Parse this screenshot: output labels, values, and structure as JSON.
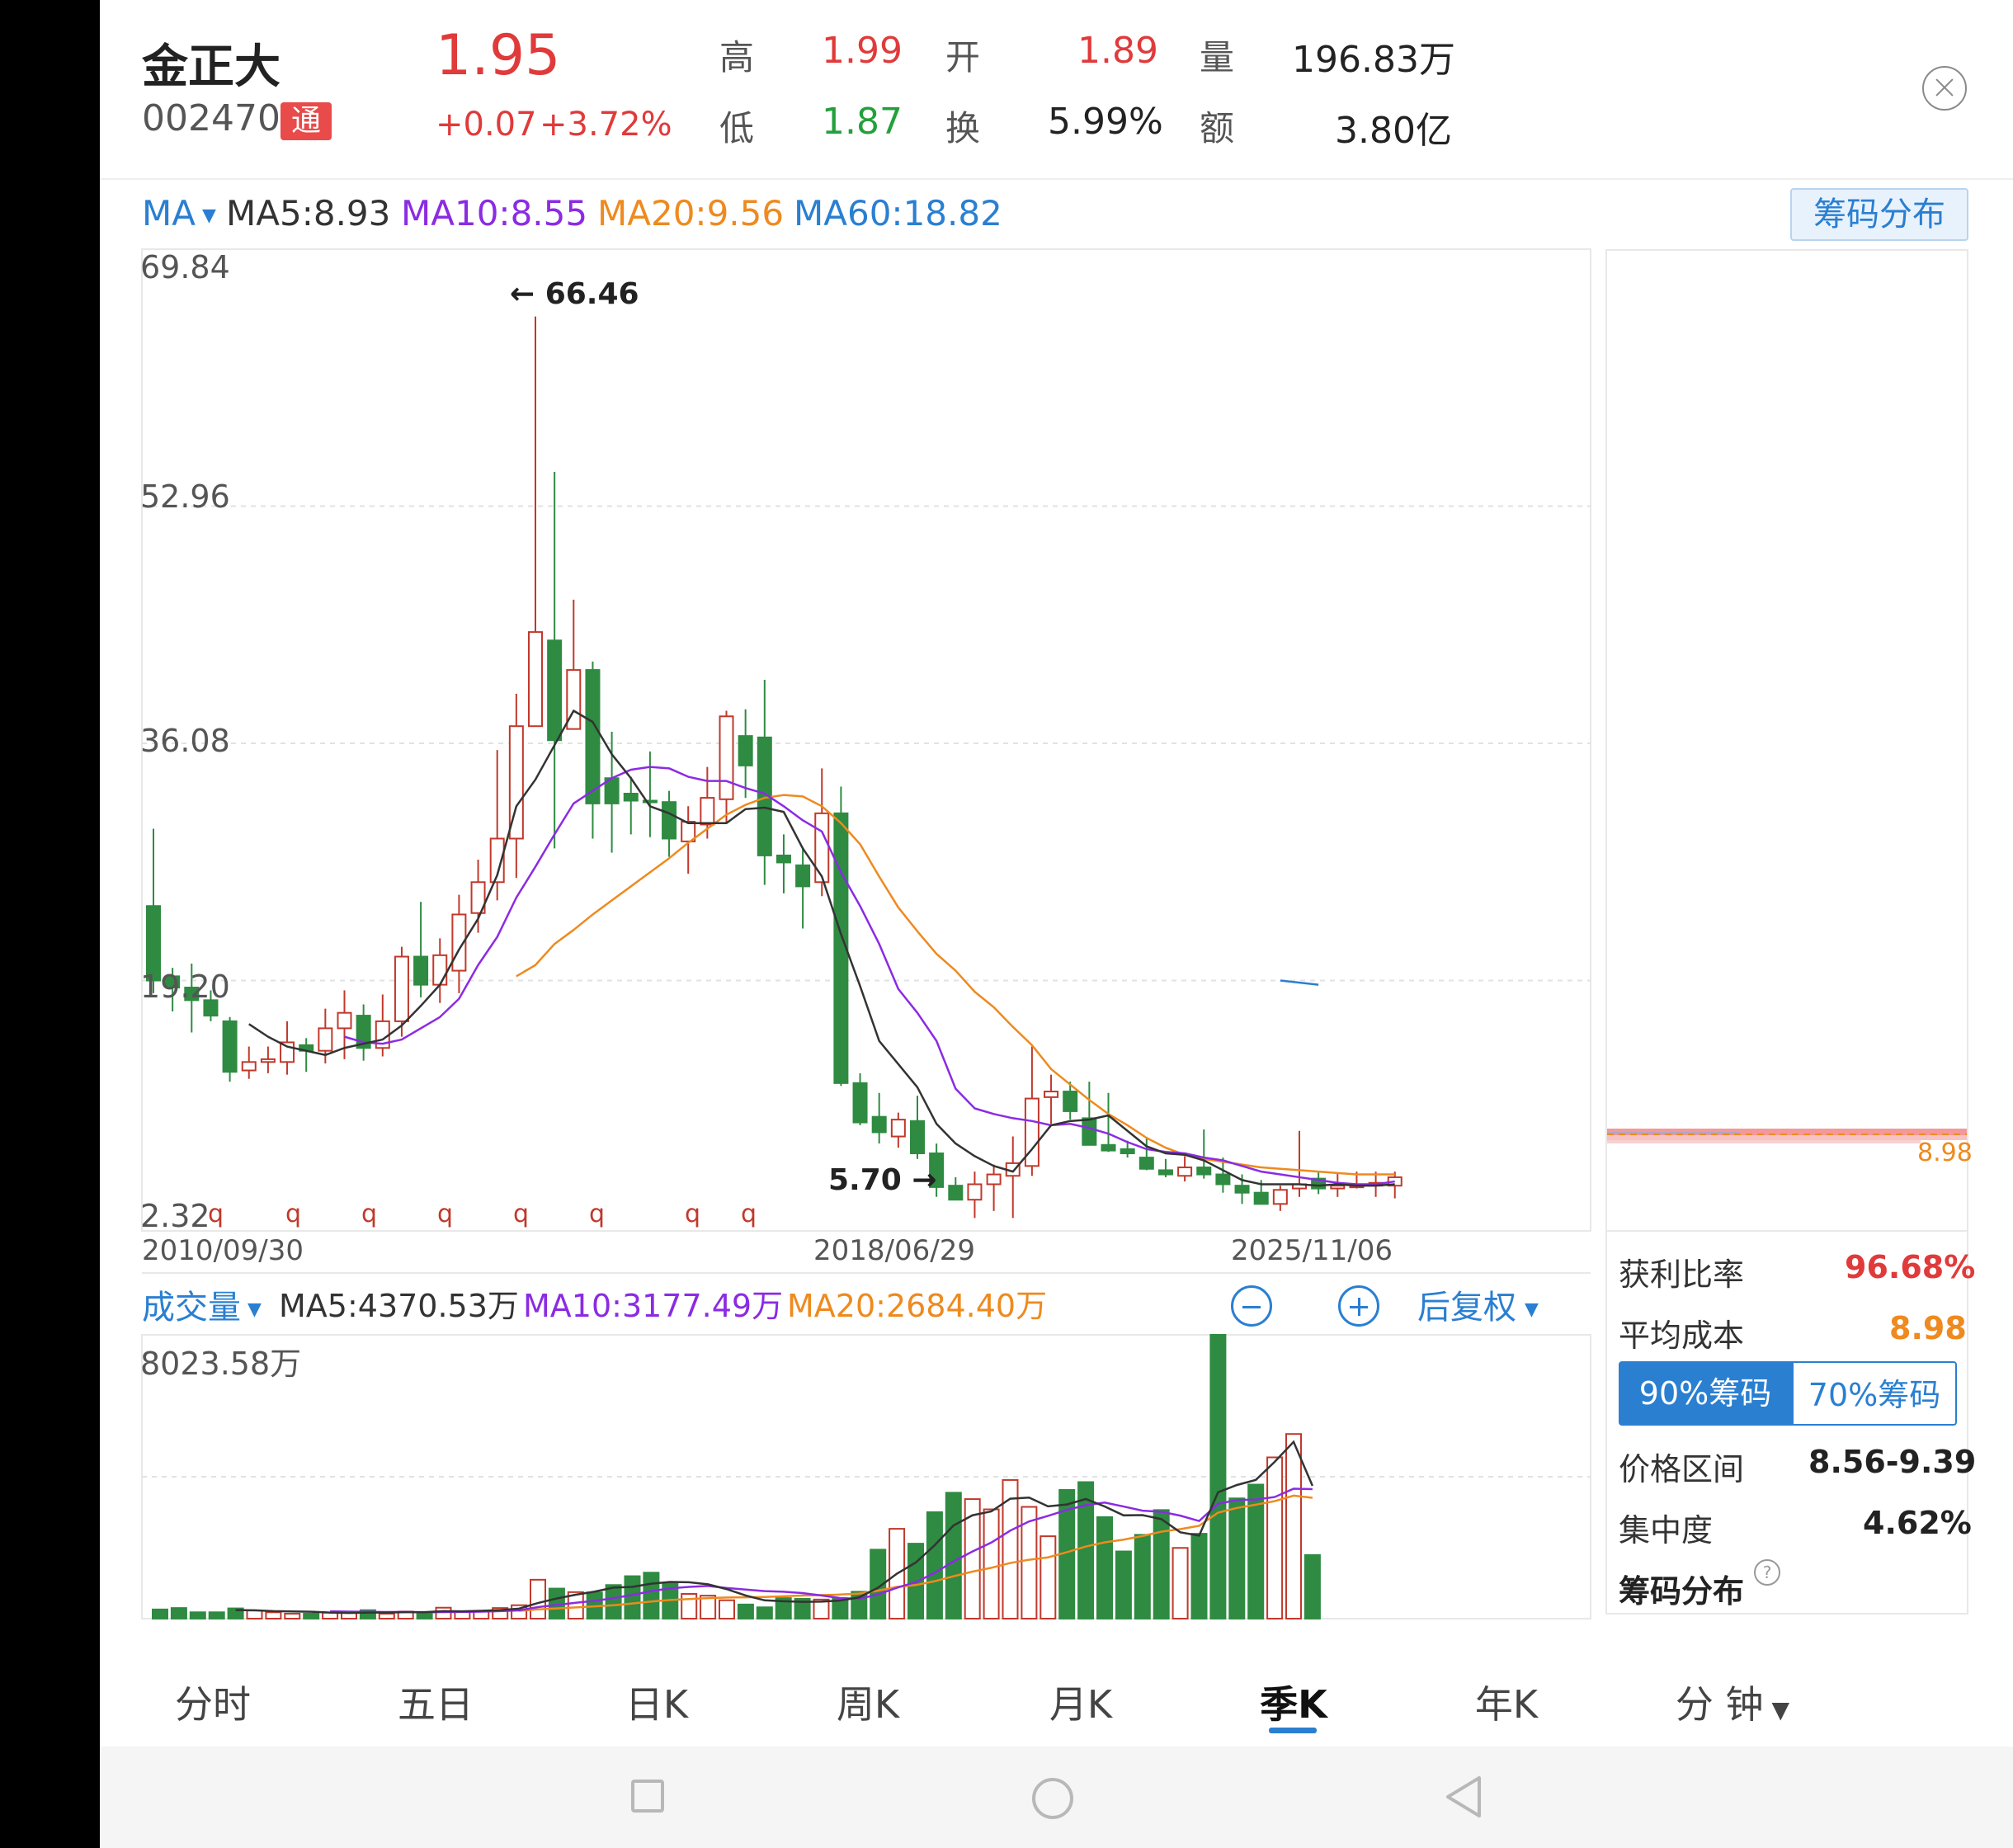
{
  "header": {
    "name": "金正大",
    "code": "002470",
    "tag": "通",
    "price": "1.95",
    "change": "+0.07",
    "change_pct": "+3.72%",
    "high_label": "高",
    "high": "1.99",
    "open_label": "开",
    "open": "1.89",
    "volume_label": "量",
    "volume": "196.83万",
    "low_label": "低",
    "low": "1.87",
    "turnover_label": "换",
    "turnover": "5.99%",
    "amount_label": "额",
    "amount": "3.80亿"
  },
  "ma_bar": {
    "label": "MA",
    "ma5": "MA5:8.93",
    "ma10": "MA10:8.55",
    "ma20": "MA20:9.56",
    "ma60": "MA60:18.82",
    "chips_button": "筹码分布"
  },
  "price_axis": [
    "69.84",
    "52.96",
    "36.08",
    "19.20",
    "2.32"
  ],
  "annotations": {
    "max": "66.46",
    "min": "5.70"
  },
  "q_marker": "q",
  "dates": [
    "2010/09/30",
    "2018/06/29",
    "2025/11/06"
  ],
  "volume_bar": {
    "label": "成交量",
    "ma5": "MA5:4370.53万",
    "ma10": "MA10:3177.49万",
    "ma20": "MA20:2684.40万",
    "max": "8023.58万",
    "adjust": "后复权"
  },
  "chip_panel": {
    "avg_price_marker": "8.98",
    "profit_label": "获利比率",
    "profit": "96.68%",
    "avg_cost_label": "平均成本",
    "avg_cost": "8.98",
    "tab_90": "90%筹码",
    "tab_70": "70%筹码",
    "range_label": "价格区间",
    "range": "8.56-9.39",
    "concentration_label": "集中度",
    "concentration": "4.62%",
    "footer": "筹码分布"
  },
  "tabs": [
    "分时",
    "五日",
    "日K",
    "周K",
    "月K",
    "季K",
    "年K",
    "分 钟"
  ],
  "active_tab": "季K",
  "colors": {
    "up": "#c0392b",
    "down": "#2e8b41",
    "ma5": "#333333",
    "ma10": "#8b2be2",
    "ma20": "#ee8a1f",
    "ma60": "#2a7fd1",
    "accent": "#2a7fd1"
  },
  "chart_data": {
    "type": "candlestick",
    "x_start": "2010/09/30",
    "x_end": "2025/11/06",
    "period": "quarter",
    "ylim": [
      2.32,
      69.84
    ],
    "candles": [
      {
        "o": 24.5,
        "h": 30.0,
        "l": 18.3,
        "c": 19.2
      },
      {
        "o": 19.5,
        "h": 20.1,
        "l": 17.0,
        "c": 18.7
      },
      {
        "o": 18.7,
        "h": 20.4,
        "l": 15.5,
        "c": 17.8
      },
      {
        "o": 17.8,
        "h": 18.5,
        "l": 16.3,
        "c": 16.7
      },
      {
        "o": 16.3,
        "h": 16.6,
        "l": 12.0,
        "c": 12.7
      },
      {
        "o": 12.8,
        "h": 14.5,
        "l": 12.2,
        "c": 13.4
      },
      {
        "o": 13.4,
        "h": 14.5,
        "l": 12.6,
        "c": 13.6
      },
      {
        "o": 13.4,
        "h": 16.3,
        "l": 12.5,
        "c": 14.8
      },
      {
        "o": 14.6,
        "h": 15.1,
        "l": 12.7,
        "c": 14.2
      },
      {
        "o": 14.2,
        "h": 17.2,
        "l": 13.3,
        "c": 15.8
      },
      {
        "o": 15.8,
        "h": 18.5,
        "l": 13.6,
        "c": 16.9
      },
      {
        "o": 16.7,
        "h": 17.5,
        "l": 13.5,
        "c": 14.4
      },
      {
        "o": 14.4,
        "h": 18.2,
        "l": 13.8,
        "c": 16.3
      },
      {
        "o": 16.3,
        "h": 21.6,
        "l": 15.2,
        "c": 20.9
      },
      {
        "o": 20.9,
        "h": 24.8,
        "l": 18.0,
        "c": 18.9
      },
      {
        "o": 18.9,
        "h": 22.2,
        "l": 17.6,
        "c": 21.0
      },
      {
        "o": 19.9,
        "h": 25.3,
        "l": 18.3,
        "c": 23.9
      },
      {
        "o": 24.0,
        "h": 27.8,
        "l": 22.6,
        "c": 26.2
      },
      {
        "o": 26.2,
        "h": 35.6,
        "l": 24.9,
        "c": 29.3
      },
      {
        "o": 29.3,
        "h": 39.6,
        "l": 26.5,
        "c": 37.3
      },
      {
        "o": 37.3,
        "h": 66.46,
        "l": 37.3,
        "c": 44.0
      },
      {
        "o": 43.4,
        "h": 55.4,
        "l": 28.6,
        "c": 36.3
      },
      {
        "o": 37.1,
        "h": 46.3,
        "l": 37.1,
        "c": 41.3
      },
      {
        "o": 41.3,
        "h": 41.9,
        "l": 29.3,
        "c": 31.8
      },
      {
        "o": 33.6,
        "h": 36.9,
        "l": 28.3,
        "c": 31.8
      },
      {
        "o": 32.5,
        "h": 33.7,
        "l": 29.6,
        "c": 32.0
      },
      {
        "o": 32.0,
        "h": 35.5,
        "l": 29.4,
        "c": 31.9
      },
      {
        "o": 31.9,
        "h": 32.7,
        "l": 28.0,
        "c": 29.3
      },
      {
        "o": 29.1,
        "h": 31.6,
        "l": 26.8,
        "c": 30.5
      },
      {
        "o": 30.3,
        "h": 34.4,
        "l": 29.3,
        "c": 32.2
      },
      {
        "o": 32.1,
        "h": 38.4,
        "l": 30.4,
        "c": 38.0
      },
      {
        "o": 36.6,
        "h": 38.5,
        "l": 32.2,
        "c": 34.5
      },
      {
        "o": 36.5,
        "h": 40.6,
        "l": 26.0,
        "c": 28.1
      },
      {
        "o": 28.1,
        "h": 29.6,
        "l": 25.4,
        "c": 27.6
      },
      {
        "o": 27.4,
        "h": 28.7,
        "l": 22.9,
        "c": 25.9
      },
      {
        "o": 26.2,
        "h": 34.3,
        "l": 25.2,
        "c": 31.1
      },
      {
        "o": 31.1,
        "h": 33.0,
        "l": 11.7,
        "c": 11.9
      },
      {
        "o": 11.9,
        "h": 12.6,
        "l": 8.9,
        "c": 9.1
      },
      {
        "o": 9.5,
        "h": 11.2,
        "l": 7.6,
        "c": 8.4
      },
      {
        "o": 8.1,
        "h": 9.8,
        "l": 7.3,
        "c": 9.3
      },
      {
        "o": 9.2,
        "h": 11.0,
        "l": 6.5,
        "c": 6.9
      },
      {
        "o": 6.9,
        "h": 7.6,
        "l": 3.8,
        "c": 4.5
      },
      {
        "o": 4.6,
        "h": 5.2,
        "l": 3.6,
        "c": 3.6
      },
      {
        "o": 3.6,
        "h": 5.6,
        "l": 2.3,
        "c": 4.7
      },
      {
        "o": 4.7,
        "h": 6.1,
        "l": 2.8,
        "c": 5.4
      },
      {
        "o": 5.3,
        "h": 8.1,
        "l": 2.3,
        "c": 6.2
      },
      {
        "o": 6.0,
        "h": 14.5,
        "l": 5.3,
        "c": 10.8
      },
      {
        "o": 10.9,
        "h": 12.5,
        "l": 9.0,
        "c": 11.3
      },
      {
        "o": 11.3,
        "h": 12.0,
        "l": 9.3,
        "c": 9.9
      },
      {
        "o": 9.4,
        "h": 12.0,
        "l": 7.9,
        "c": 7.5
      },
      {
        "o": 7.5,
        "h": 11.2,
        "l": 7.0,
        "c": 7.1
      },
      {
        "o": 7.2,
        "h": 7.8,
        "l": 6.6,
        "c": 6.9
      },
      {
        "o": 6.6,
        "h": 8.0,
        "l": 5.7,
        "c": 5.8
      },
      {
        "o": 5.7,
        "h": 6.5,
        "l": 5.2,
        "c": 5.4
      },
      {
        "o": 5.3,
        "h": 6.7,
        "l": 4.9,
        "c": 5.9
      },
      {
        "o": 5.9,
        "h": 8.6,
        "l": 5.1,
        "c": 5.4
      },
      {
        "o": 5.4,
        "h": 6.6,
        "l": 4.1,
        "c": 4.7
      },
      {
        "o": 4.6,
        "h": 5.4,
        "l": 3.3,
        "c": 4.1
      },
      {
        "o": 4.1,
        "h": 5.0,
        "l": 3.3,
        "c": 3.3
      },
      {
        "o": 3.3,
        "h": 4.6,
        "l": 2.8,
        "c": 4.3
      },
      {
        "o": 4.4,
        "h": 8.5,
        "l": 3.8,
        "c": 4.7
      },
      {
        "o": 5.1,
        "h": 5.6,
        "l": 4.0,
        "c": 4.4
      },
      {
        "o": 4.4,
        "h": 5.5,
        "l": 3.8,
        "c": 4.6
      },
      {
        "o": 4.6,
        "h": 5.6,
        "l": 4.4,
        "c": 4.6
      },
      {
        "o": 4.6,
        "h": 5.6,
        "l": 3.8,
        "c": 4.8
      },
      {
        "o": 4.6,
        "h": 5.6,
        "l": 3.7,
        "c": 5.2
      }
    ],
    "ma5": [
      [
        5,
        16.1
      ],
      [
        6,
        15.2
      ],
      [
        7,
        14.5
      ],
      [
        9,
        13.9
      ],
      [
        10,
        14.4
      ],
      [
        12,
        15.0
      ],
      [
        13,
        16.0
      ],
      [
        14,
        17.4
      ],
      [
        15,
        18.9
      ],
      [
        16,
        21.4
      ],
      [
        17,
        23.6
      ],
      [
        18,
        26.7
      ],
      [
        19,
        31.6
      ],
      [
        20,
        33.5
      ],
      [
        22,
        38.4
      ],
      [
        23,
        37.6
      ],
      [
        24,
        35.3
      ],
      [
        25,
        33.6
      ],
      [
        26,
        31.6
      ],
      [
        27,
        31.1
      ],
      [
        28,
        30.4
      ],
      [
        30,
        30.4
      ],
      [
        31,
        31.4
      ],
      [
        32,
        31.5
      ],
      [
        33,
        31.2
      ],
      [
        34,
        28.6
      ],
      [
        35,
        26.6
      ],
      [
        36,
        22.5
      ],
      [
        37,
        18.8
      ],
      [
        38,
        14.9
      ],
      [
        40,
        11.6
      ],
      [
        41,
        9.0
      ],
      [
        42,
        7.6
      ],
      [
        43,
        6.7
      ],
      [
        44,
        6.0
      ],
      [
        45,
        5.6
      ],
      [
        46,
        7.2
      ],
      [
        47,
        8.9
      ],
      [
        48,
        9.2
      ],
      [
        49,
        9.3
      ],
      [
        50,
        9.6
      ],
      [
        51,
        8.5
      ],
      [
        52,
        7.4
      ],
      [
        53,
        6.9
      ],
      [
        54,
        6.8
      ],
      [
        55,
        6.4
      ],
      [
        56,
        5.7
      ],
      [
        57,
        5.0
      ],
      [
        58,
        4.7
      ],
      [
        59,
        4.7
      ],
      [
        60,
        4.7
      ],
      [
        61,
        4.6
      ],
      [
        62,
        4.7
      ],
      [
        63,
        4.6
      ],
      [
        64,
        4.6
      ],
      [
        65,
        4.7
      ]
    ],
    "ma10": [
      [
        10,
        15.2
      ],
      [
        11,
        14.8
      ],
      [
        12,
        14.7
      ],
      [
        13,
        15.0
      ],
      [
        14,
        15.8
      ],
      [
        15,
        16.6
      ],
      [
        16,
        17.9
      ],
      [
        17,
        20.3
      ],
      [
        18,
        22.3
      ],
      [
        19,
        25.1
      ],
      [
        20,
        27.3
      ],
      [
        21,
        29.6
      ],
      [
        22,
        31.8
      ],
      [
        23,
        32.7
      ],
      [
        24,
        33.6
      ],
      [
        25,
        34.2
      ],
      [
        26,
        34.4
      ],
      [
        27,
        34.3
      ],
      [
        28,
        33.7
      ],
      [
        29,
        33.4
      ],
      [
        30,
        33.4
      ],
      [
        31,
        32.9
      ],
      [
        32,
        32.5
      ],
      [
        33,
        31.6
      ],
      [
        34,
        30.6
      ],
      [
        35,
        29.8
      ],
      [
        36,
        26.9
      ],
      [
        37,
        24.5
      ],
      [
        38,
        21.8
      ],
      [
        39,
        18.6
      ],
      [
        40,
        16.9
      ],
      [
        41,
        14.9
      ],
      [
        42,
        11.5
      ],
      [
        43,
        10.1
      ],
      [
        44,
        9.7
      ],
      [
        45,
        9.4
      ],
      [
        46,
        9.2
      ],
      [
        47,
        8.9
      ],
      [
        48,
        9.0
      ],
      [
        49,
        8.7
      ],
      [
        50,
        8.3
      ],
      [
        51,
        7.7
      ],
      [
        52,
        7.2
      ],
      [
        53,
        7.0
      ],
      [
        54,
        6.9
      ],
      [
        55,
        6.6
      ],
      [
        56,
        6.4
      ],
      [
        57,
        6.0
      ],
      [
        58,
        5.6
      ],
      [
        59,
        5.4
      ],
      [
        60,
        5.2
      ],
      [
        61,
        5.0
      ],
      [
        62,
        4.8
      ],
      [
        63,
        4.7
      ],
      [
        64,
        4.7
      ],
      [
        65,
        4.9
      ]
    ],
    "ma20": [
      [
        19,
        19.5
      ],
      [
        20,
        20.3
      ],
      [
        21,
        21.8
      ],
      [
        22,
        22.8
      ],
      [
        23,
        23.9
      ],
      [
        24,
        24.9
      ],
      [
        25,
        25.9
      ],
      [
        26,
        26.9
      ],
      [
        27,
        27.9
      ],
      [
        28,
        29.0
      ],
      [
        29,
        30.0
      ],
      [
        30,
        31.0
      ],
      [
        31,
        31.7
      ],
      [
        32,
        32.2
      ],
      [
        33,
        32.4
      ],
      [
        34,
        32.3
      ],
      [
        35,
        31.6
      ],
      [
        36,
        30.4
      ],
      [
        37,
        28.9
      ],
      [
        38,
        26.6
      ],
      [
        39,
        24.4
      ],
      [
        40,
        22.7
      ],
      [
        41,
        21.1
      ],
      [
        42,
        19.9
      ],
      [
        43,
        18.4
      ],
      [
        44,
        17.3
      ],
      [
        45,
        15.9
      ],
      [
        46,
        14.6
      ],
      [
        47,
        12.9
      ],
      [
        48,
        11.8
      ],
      [
        49,
        10.7
      ],
      [
        50,
        9.7
      ],
      [
        51,
        8.9
      ],
      [
        52,
        8.0
      ],
      [
        53,
        7.3
      ],
      [
        54,
        6.8
      ],
      [
        55,
        6.5
      ],
      [
        56,
        6.3
      ],
      [
        57,
        6.1
      ],
      [
        58,
        5.9
      ],
      [
        59,
        5.8
      ],
      [
        60,
        5.7
      ],
      [
        61,
        5.6
      ],
      [
        62,
        5.5
      ],
      [
        63,
        5.4
      ],
      [
        64,
        5.4
      ],
      [
        65,
        5.4
      ]
    ],
    "ma60_segment": [
      [
        59,
        19.2
      ],
      [
        61,
        18.9
      ]
    ],
    "volume_max": 8023.58,
    "volume": [
      260,
      300,
      180,
      180,
      290,
      230,
      180,
      140,
      140,
      170,
      170,
      240,
      140,
      200,
      170,
      310,
      210,
      220,
      300,
      380,
      1100,
      850,
      750,
      740,
      950,
      1200,
      1300,
      1000,
      700,
      650,
      520,
      400,
      320,
      580,
      560,
      540,
      560,
      760,
      1950,
      2540,
      2120,
      3010,
      3560,
      3380,
      3090,
      3920,
      3160,
      2330,
      3640,
      3860,
      2870,
      1900,
      2370,
      3070,
      2000,
      2400,
      8023.58,
      3400,
      3790,
      4560,
      5220,
      1800
    ]
  }
}
